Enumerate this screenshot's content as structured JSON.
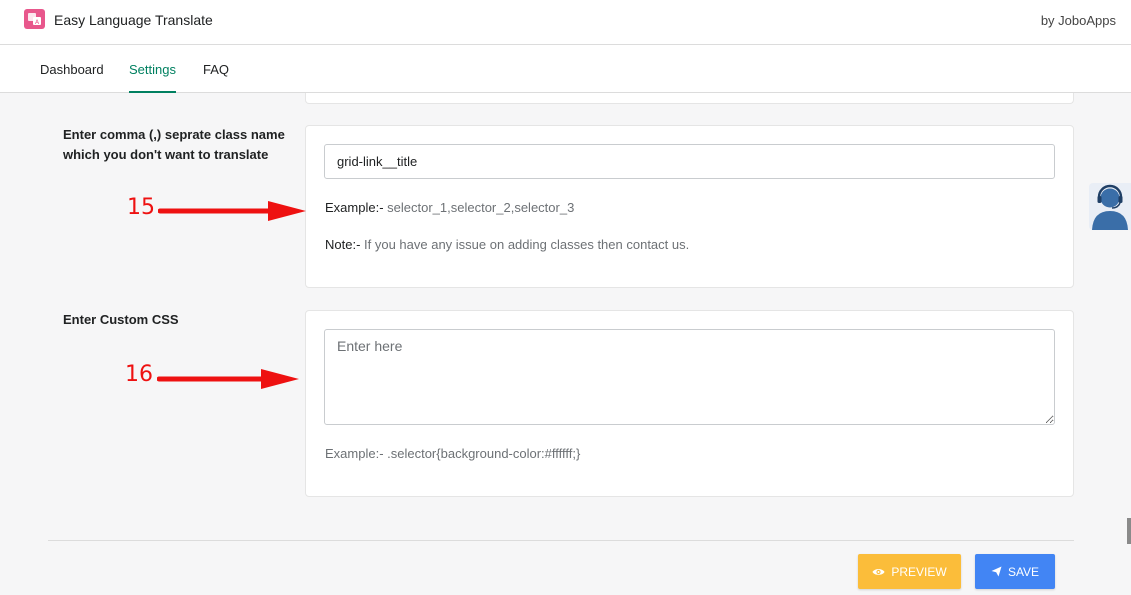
{
  "app": {
    "title": "Easy Language Translate",
    "by": "by JoboApps",
    "logo_icon": "translate-logo-icon",
    "accent_color": "#008060"
  },
  "tabs": [
    {
      "label": "Dashboard",
      "active": false
    },
    {
      "label": "Settings",
      "active": true
    },
    {
      "label": "FAQ",
      "active": false
    }
  ],
  "exclude_classes": {
    "label": "Enter comma (,) seprate class name which you don't want to translate",
    "value": "grid-link__title",
    "example_label": "Example:-",
    "example_value": " selector_1,selector_2,selector_3",
    "note_label": "Note:-",
    "note_value": " If you have any issue on adding classes then contact us."
  },
  "custom_css": {
    "label": "Enter Custom CSS",
    "placeholder": "Enter here",
    "example": "Example:- .selector{background-color:#ffffff;}"
  },
  "buttons": {
    "preview": {
      "label": "PREVIEW",
      "icon": "eye-icon",
      "color": "#fbbd3a"
    },
    "save": {
      "label": "SAVE",
      "icon": "paper-plane-icon",
      "color": "#4285f4"
    }
  },
  "annotations": {
    "step_15": "15",
    "step_16": "16",
    "color": "#ee1111"
  },
  "support": {
    "icon": "support-agent-icon"
  }
}
